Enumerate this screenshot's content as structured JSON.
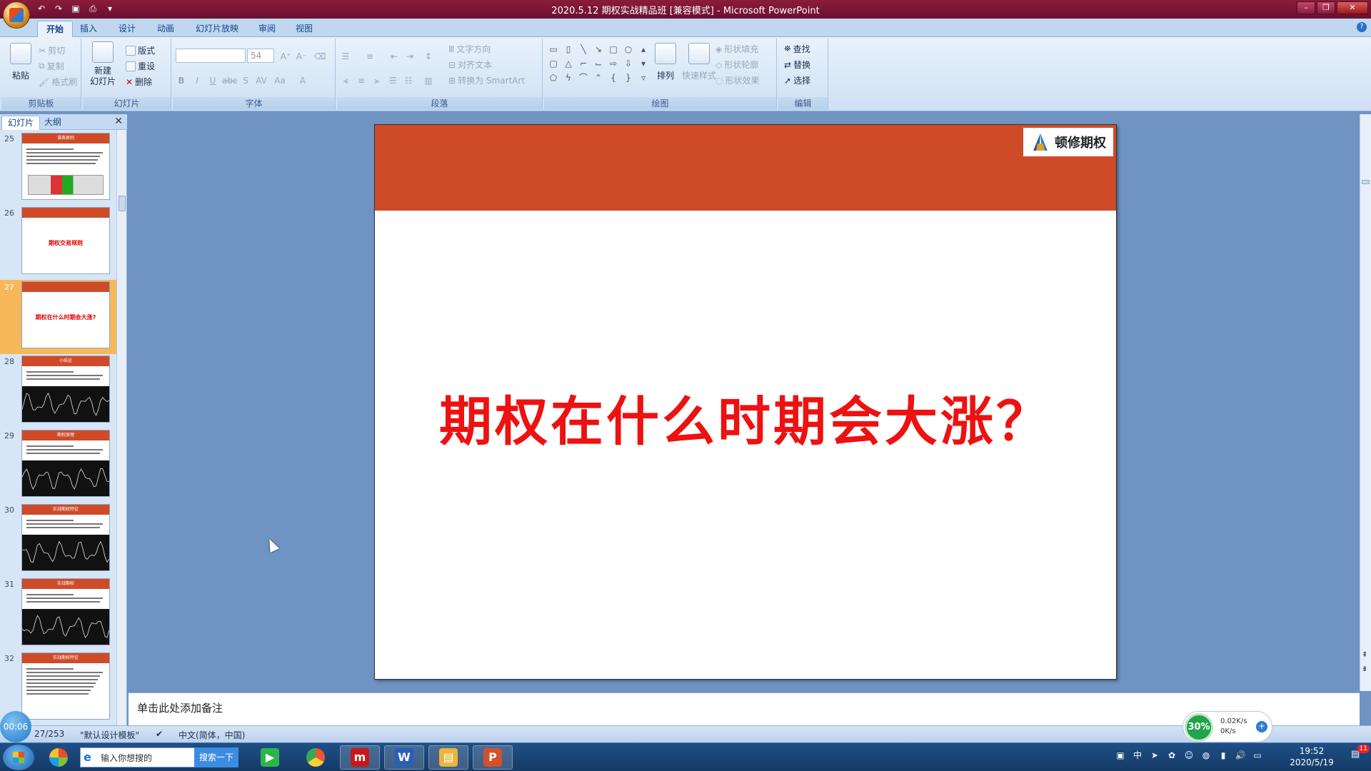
{
  "window": {
    "title": "2020.5.12 期权实战精品班 [兼容模式] - Microsoft PowerPoint",
    "controls": [
      "minimize",
      "restore",
      "close"
    ]
  },
  "qat_icons": [
    "undo-icon",
    "redo-icon",
    "save-icon",
    "print-icon",
    "customize-icon"
  ],
  "ribbon": {
    "tabs": [
      "开始",
      "插入",
      "设计",
      "动画",
      "幻灯片放映",
      "审阅",
      "视图"
    ],
    "active_tab": "开始",
    "clipboard": {
      "paste": "粘贴",
      "cut": "剪切",
      "copy": "复制",
      "format_painter": "格式刷",
      "label": "剪贴板"
    },
    "slides": {
      "new_slide_line1": "新建",
      "new_slide_line2": "幻灯片",
      "layout": "版式",
      "reset": "重设",
      "delete": "删除",
      "label": "幻灯片"
    },
    "font": {
      "font_name": "",
      "font_size": "54",
      "label": "字体"
    },
    "paragraph": {
      "text_direction": "文字方向",
      "align_text": "对齐文本",
      "convert_smartart": "转换为 SmartArt",
      "label": "段落"
    },
    "drawing": {
      "arrange": "排列",
      "quick_styles": "快速样式",
      "shape_fill": "形状填充",
      "shape_outline": "形状轮廓",
      "shape_effects": "形状效果",
      "label": "绘图"
    },
    "editing": {
      "find": "查找",
      "replace": "替换",
      "select": "选择",
      "label": "编辑"
    }
  },
  "panel": {
    "tabs": [
      "幻灯片",
      "大纲"
    ],
    "active_tab": "幻灯片",
    "thumbnails": [
      {
        "num": "25",
        "type": "bullets",
        "heading": "课表原则"
      },
      {
        "num": "26",
        "type": "title",
        "title": "期权交易规则"
      },
      {
        "num": "27",
        "type": "title",
        "title": "期权在什么时期会大涨?",
        "selected": true
      },
      {
        "num": "28",
        "type": "chart",
        "heading": "小结论"
      },
      {
        "num": "29",
        "type": "chart",
        "heading": "期权原理"
      },
      {
        "num": "30",
        "type": "chart",
        "heading": "实战期权特征"
      },
      {
        "num": "31",
        "type": "chart",
        "heading": "实战期权"
      },
      {
        "num": "32",
        "type": "bullets2",
        "heading": "实战期权特征"
      }
    ]
  },
  "slide": {
    "logo_text": "顿修期权",
    "title": "期权在什么时期会大涨？",
    "colors": {
      "header": "#cf4b27",
      "title": "#ee1111"
    }
  },
  "notes": {
    "placeholder": "单击此处添加备注"
  },
  "status": {
    "slide_counter": "27/253",
    "theme": "\"默认设计模板\"",
    "language": "中文(简体，中国)",
    "timer": "00:06"
  },
  "netmon": {
    "percent": "30%",
    "up": "0.02K/s",
    "down": "0K/s"
  },
  "taskbar": {
    "search_placeholder": "输入你想搜的",
    "search_button": "搜索一下",
    "time": "19:52",
    "date": "2020/5/19",
    "notification_count": "11"
  }
}
